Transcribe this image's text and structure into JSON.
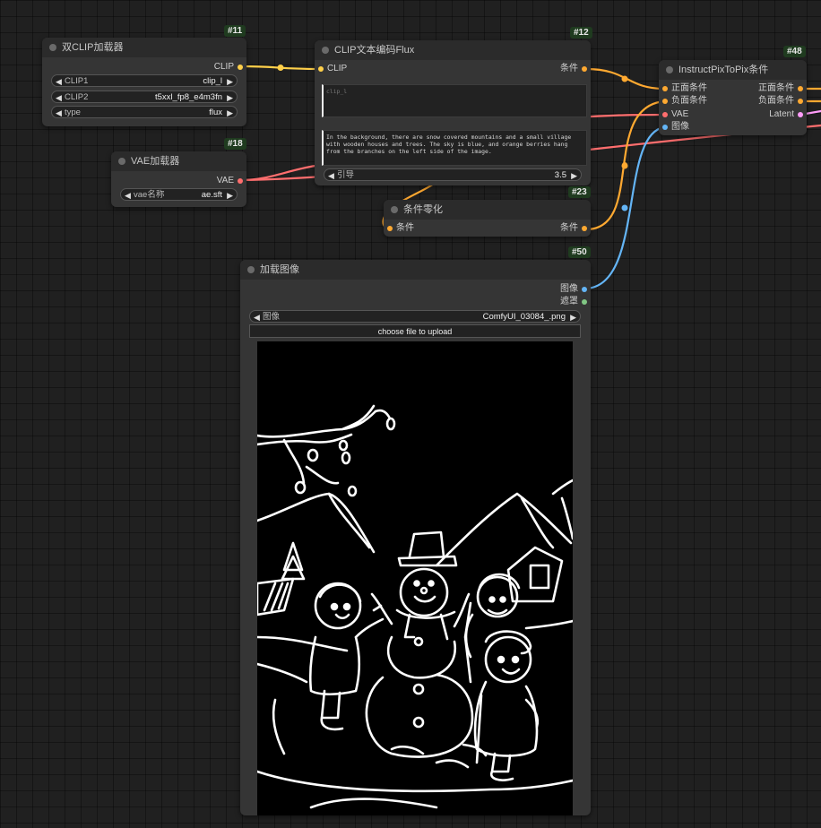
{
  "colors": {
    "clip": "#ffd04a",
    "conditioning": "#ffa931",
    "vae": "#ff6e6e",
    "image": "#64b5f6",
    "mask": "#81c784",
    "latent": "#ff9cf9"
  },
  "nodes": {
    "dual_clip_loader": {
      "id": "#11",
      "title": "双CLIP加载器",
      "output_clip": "CLIP",
      "widgets": [
        {
          "label": "CLIP1",
          "value": "clip_l"
        },
        {
          "label": "CLIP2",
          "value": "t5xxl_fp8_e4m3fn"
        },
        {
          "label": "type",
          "value": "flux"
        }
      ]
    },
    "vae_loader": {
      "id": "#18",
      "title": "VAE加载器",
      "output_vae": "VAE",
      "widget": {
        "label": "vae名称",
        "value": "ae.sft"
      }
    },
    "clip_text_encode_flux": {
      "id": "#12",
      "title": "CLIP文本编码Flux",
      "input_clip": "CLIP",
      "output_conditioning": "条件",
      "clip_l_placeholder": "clip_l",
      "t5xxl_text": "In the background, there are snow covered mountains and a small village with wooden houses and trees. The sky is blue, and orange berries hang from the branches on the left side of the image.",
      "guidance": {
        "label": "引导",
        "value": "3.5"
      }
    },
    "conditioning_zero_out": {
      "id": "#23",
      "title": "条件零化",
      "input": "条件",
      "output": "条件"
    },
    "instruct_pix2pix": {
      "id": "#48",
      "title": "InstructPixToPix条件",
      "inputs": [
        "正面条件",
        "负面条件",
        "VAE",
        "图像"
      ],
      "outputs": [
        "正面条件",
        "负面条件",
        "Latent"
      ]
    },
    "load_image": {
      "id": "#50",
      "title": "加载图像",
      "outputs": [
        "图像",
        "遮罩"
      ],
      "widget": {
        "label": "图像",
        "value": "ComfyUI_03084_.png"
      },
      "upload_label": "choose file to upload"
    }
  }
}
